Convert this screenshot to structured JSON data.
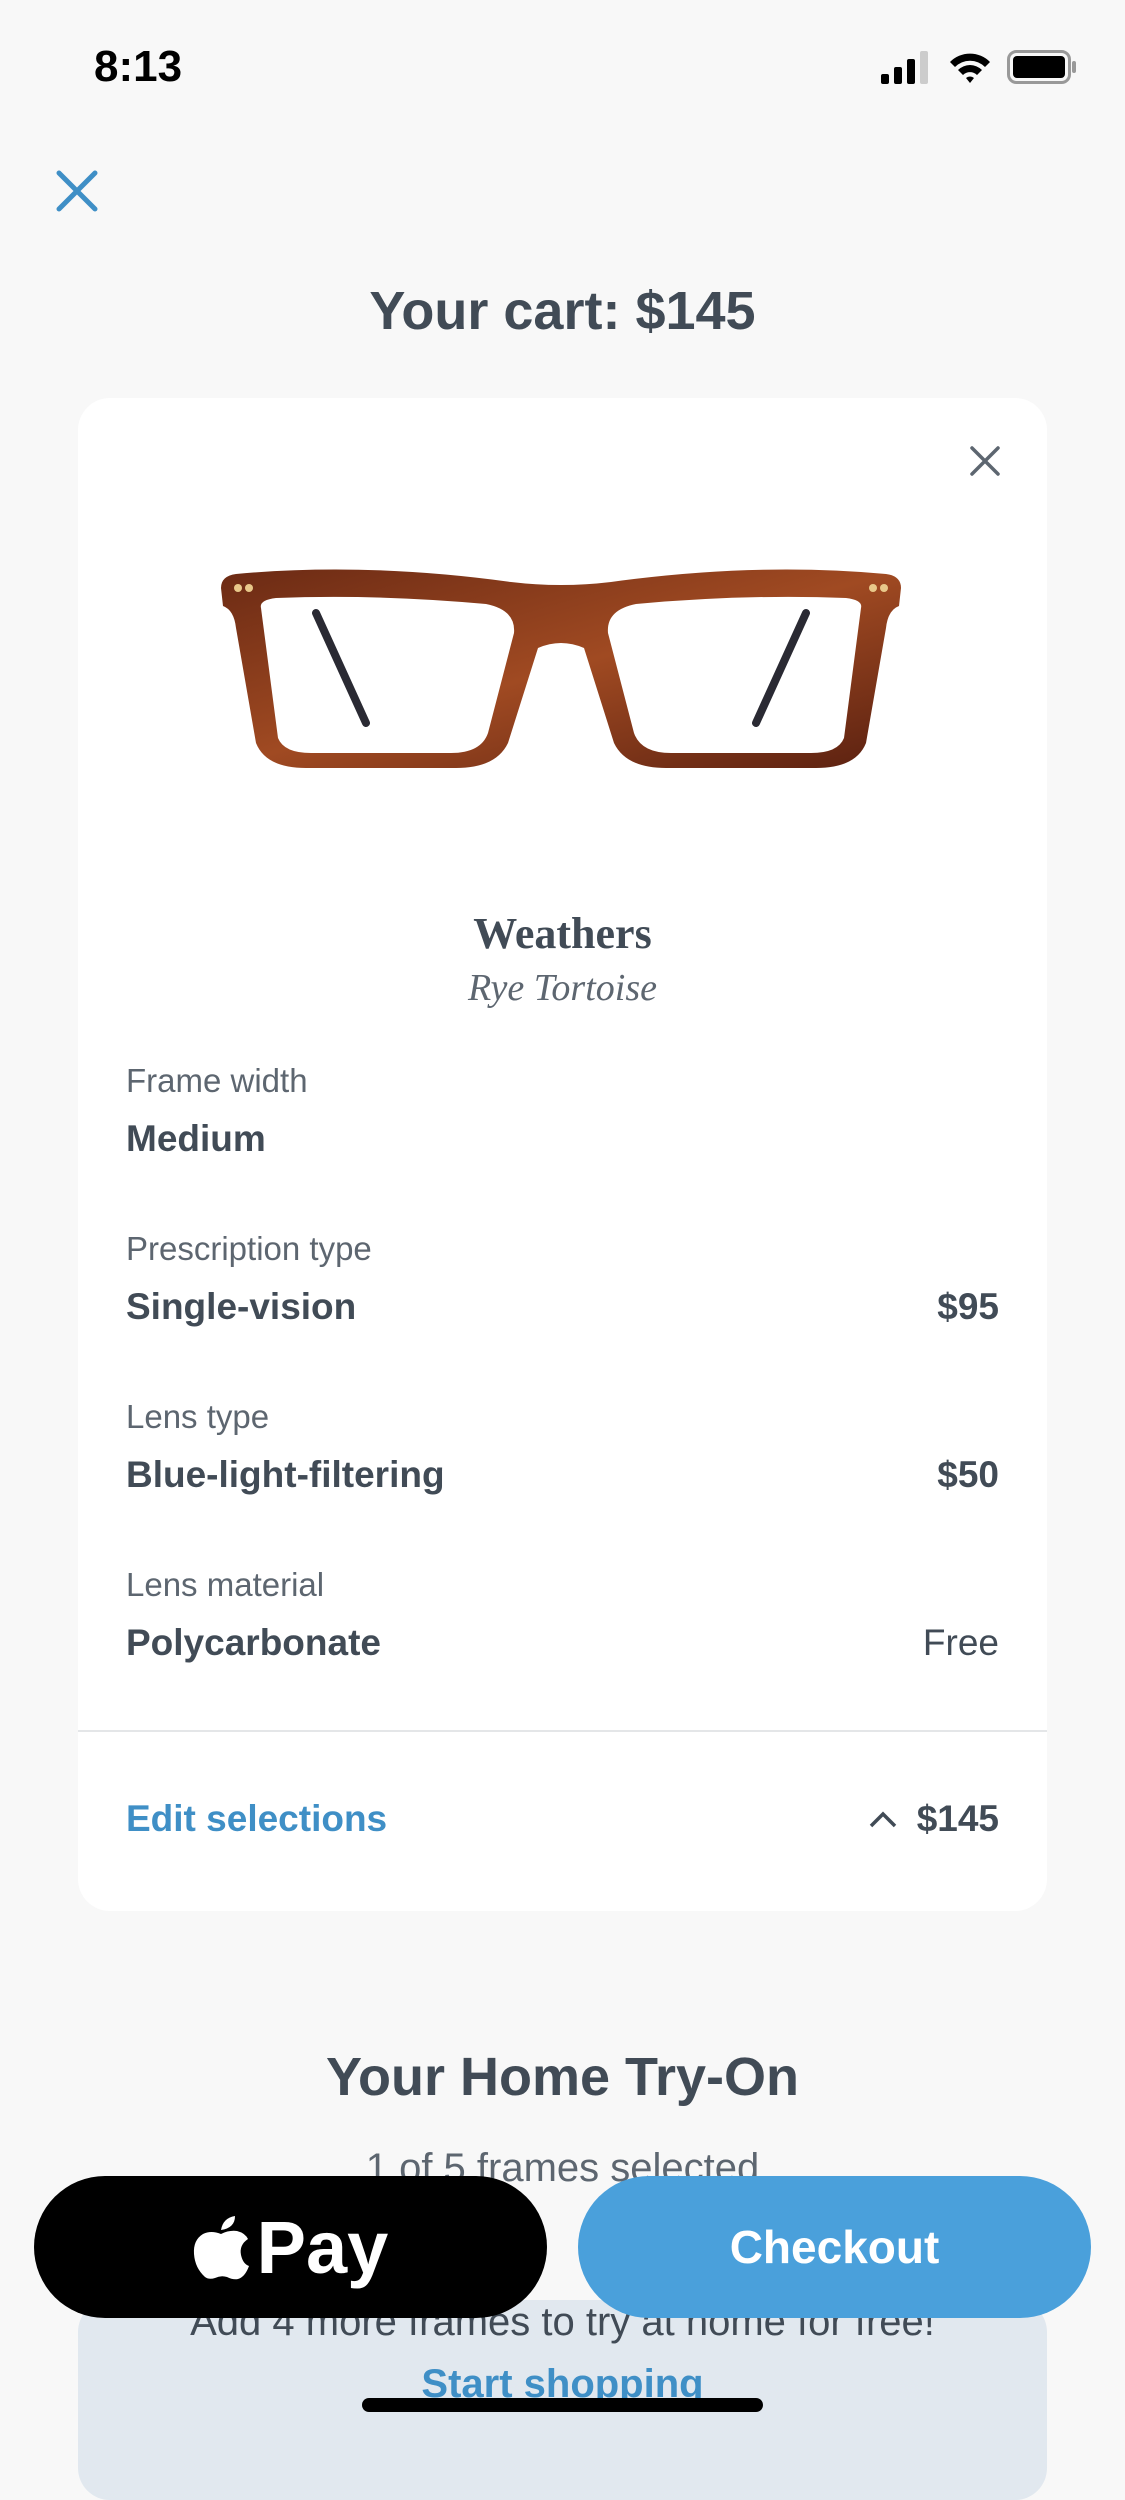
{
  "status_bar": {
    "time": "8:13"
  },
  "header": {
    "title": "Your cart: $145"
  },
  "cart_item": {
    "name": "Weathers",
    "color": "Rye Tortoise",
    "options": [
      {
        "label": "Frame width",
        "value": "Medium",
        "price": ""
      },
      {
        "label": "Prescription type",
        "value": "Single-vision",
        "price": "$95"
      },
      {
        "label": "Lens type",
        "value": "Blue-light-filtering",
        "price": "$50"
      },
      {
        "label": "Lens material",
        "value": "Polycarbonate",
        "price": "Free"
      }
    ],
    "edit_label": "Edit selections",
    "total": "$145"
  },
  "home_try_on": {
    "title": "Your Home Try-On",
    "selected": "1 of 5 frames selected",
    "promo": "Add 4 more frames to try at home for free!",
    "start_shopping": "Start shopping"
  },
  "buttons": {
    "apple_pay": "Pay",
    "checkout": "Checkout"
  },
  "colors": {
    "accent": "#3f8fc6",
    "checkout": "#4aa0db",
    "text": "#414b56"
  }
}
